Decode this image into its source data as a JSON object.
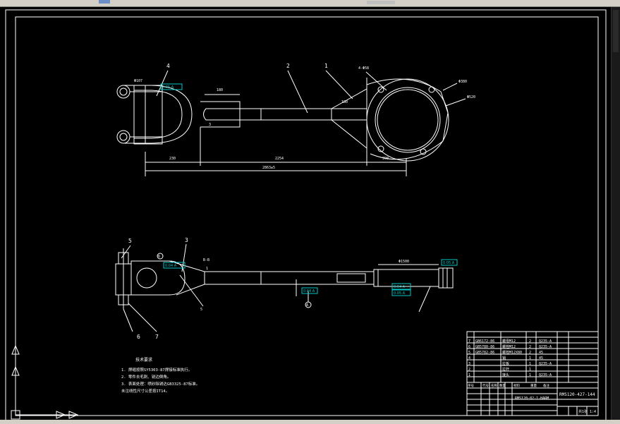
{
  "drawing": {
    "title_block_number": "RMS120-427-144",
    "drawing_name": "RMS120-02-1-HARM",
    "scale": "1:4",
    "sheet_label": "共1张",
    "balloons": {
      "top_view": [
        "4",
        "2",
        "1",
        "3"
      ],
      "side_view": [
        "5",
        "3",
        "6",
        "7"
      ]
    },
    "top_view_dims": {
      "upper_a": "180",
      "lower_left": "230",
      "lower_mid": "2254",
      "lower_right": "390",
      "overall": "2863±5",
      "hole_note": "4-Φ58",
      "right_a": "Φ380",
      "right_b": "Φ520",
      "clevis": "Φ107",
      "arm_tag": "180"
    },
    "side_view_dims": {
      "right_len": "Φ1500",
      "mark_a": "A",
      "note_a": "6",
      "note_b": "5",
      "note_c": "1",
      "note_label": "B-B"
    },
    "tolerance_tags": [
      "0.05 A",
      "0.04 A",
      "0.04 A",
      "0.04 A",
      "0.05 A",
      "0.05 A"
    ],
    "tech_notes": {
      "heading": "技术要求",
      "lines": [
        "1. 焊缝按照SY5303-87焊接标准执行。",
        "2. 零件去毛刺、锐边倒角。",
        "3. 表面处理：喷砂除锈达GB3325-87标准。",
        "   未注线性尺寸公差按IT14。"
      ]
    },
    "bom": [
      {
        "no": "7",
        "code": "GB6172-86",
        "name": "螺母M12",
        "qty": "2",
        "material": "Q235-A"
      },
      {
        "no": "6",
        "code": "GB5780-86",
        "name": "螺栓M12",
        "qty": "2",
        "material": "Q235-A"
      },
      {
        "no": "5",
        "code": "GB5782-86",
        "name": "螺栓M12X80",
        "qty": "2",
        "material": "45"
      },
      {
        "no": "4",
        "code": "",
        "name": "销",
        "qty": "1",
        "material": "45"
      },
      {
        "no": "3",
        "code": "",
        "name": "拉板",
        "qty": "1",
        "material": "Q235-A"
      },
      {
        "no": "2",
        "code": "",
        "name": "拉杆",
        "qty": "1",
        "material": ""
      },
      {
        "no": "1",
        "code": "",
        "name": "接头",
        "qty": "1",
        "material": "Q235-A"
      }
    ],
    "bom_header": [
      "序号",
      "代号",
      "名称",
      "数量",
      "材料",
      "重量",
      "备注"
    ]
  },
  "colors": {
    "background": "#000000",
    "lines": "#ffffff",
    "tag": "#00c8c8"
  },
  "icons": {
    "ucs": "ucs-icon"
  }
}
